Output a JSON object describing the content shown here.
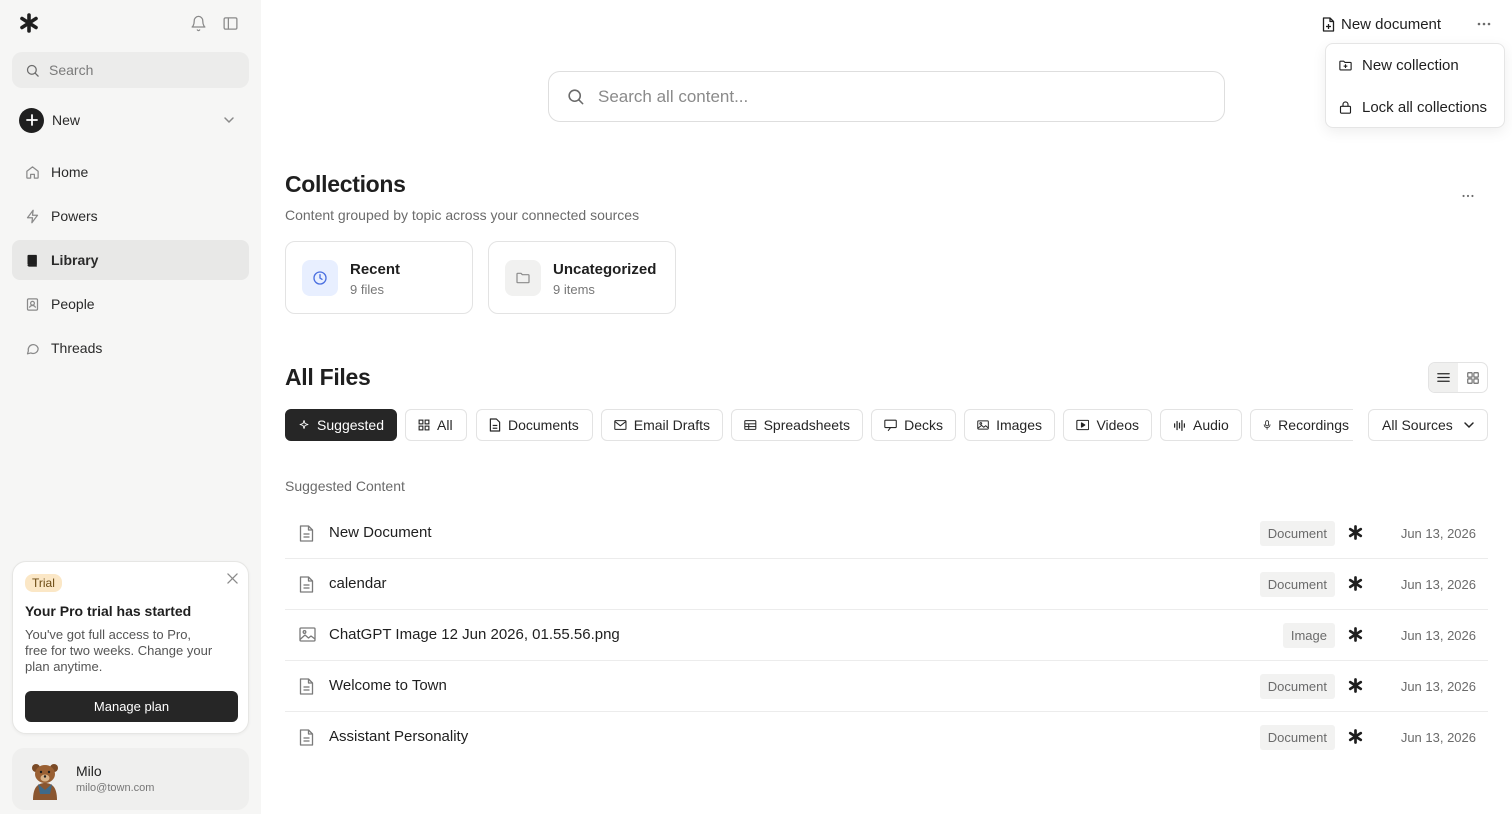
{
  "sidebar": {
    "search_placeholder": "Search",
    "new_label": "New",
    "nav": [
      {
        "label": "Home",
        "icon": "home-icon",
        "active": false
      },
      {
        "label": "Powers",
        "icon": "bolt-icon",
        "active": false
      },
      {
        "label": "Library",
        "icon": "book-icon",
        "active": true
      },
      {
        "label": "People",
        "icon": "contact-icon",
        "active": false
      },
      {
        "label": "Threads",
        "icon": "chat-icon",
        "active": false
      }
    ],
    "trial": {
      "badge": "Trial",
      "title": "Your Pro trial has started",
      "text": "You've got full access to Pro, free for two weeks. Change your plan anytime.",
      "button": "Manage plan"
    },
    "user": {
      "name": "Milo",
      "email": "milo@town.com"
    }
  },
  "topbar": {
    "new_document": "New document",
    "menu": [
      "New collection",
      "Lock all collections"
    ]
  },
  "search": {
    "placeholder": "Search all content..."
  },
  "collections": {
    "title": "Collections",
    "subtitle": "Content grouped by topic across your connected sources",
    "cards": [
      {
        "name": "Recent",
        "count": "9 files",
        "icon": "clock-icon",
        "accent": "#e8efff"
      },
      {
        "name": "Uncategorized",
        "count": "9 items",
        "icon": "folder-icon",
        "accent": "#f1f1f0"
      }
    ]
  },
  "all_files": {
    "title": "All Files",
    "filters": [
      "Suggested",
      "All",
      "Documents",
      "Email Drafts",
      "Spreadsheets",
      "Decks",
      "Images",
      "Videos",
      "Audio",
      "Recordings"
    ],
    "active_filter": "Suggested",
    "sources": "All Sources",
    "section_label": "Suggested Content",
    "rows": [
      {
        "name": "New Document",
        "type": "Document",
        "date": "Jun 13, 2026",
        "icon": "document-icon"
      },
      {
        "name": "calendar",
        "type": "Document",
        "date": "Jun 13, 2026",
        "icon": "document-icon"
      },
      {
        "name": "ChatGPT Image 12 Jun 2026, 01.55.56.png",
        "type": "Image",
        "date": "Jun 13, 2026",
        "icon": "image-icon"
      },
      {
        "name": "Welcome to Town",
        "type": "Document",
        "date": "Jun 13, 2026",
        "icon": "document-icon"
      },
      {
        "name": "Assistant Personality",
        "type": "Document",
        "date": "Jun 13, 2026",
        "icon": "document-icon"
      }
    ]
  }
}
